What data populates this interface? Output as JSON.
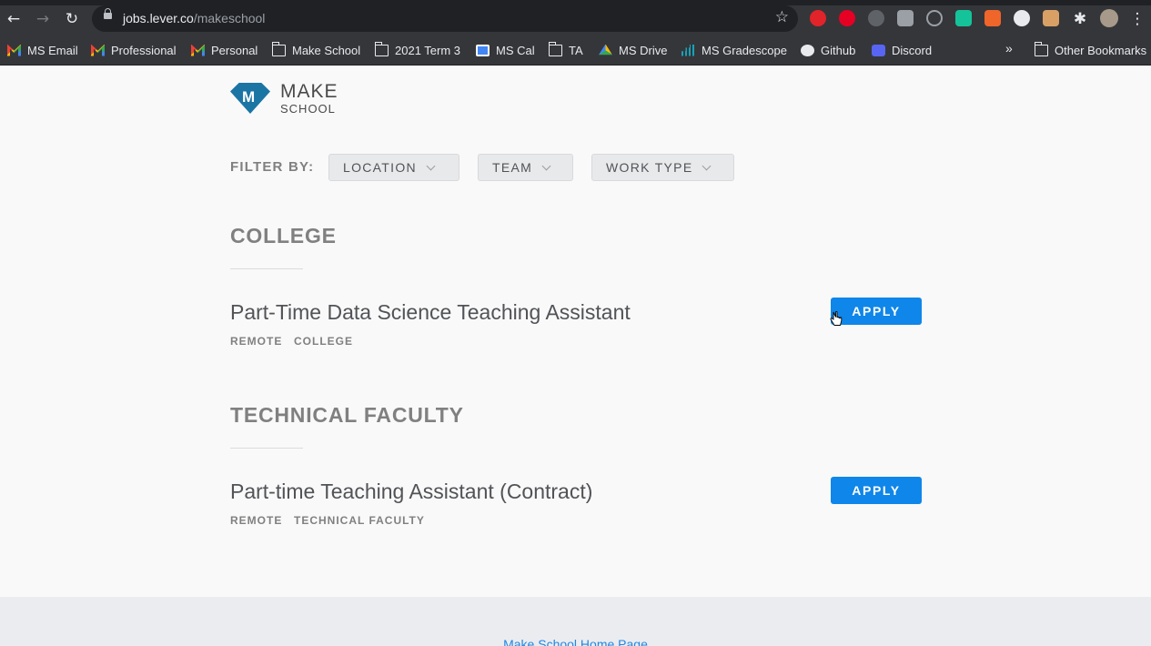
{
  "browser": {
    "url_host": "jobs.lever.co",
    "url_path": "/makeschool",
    "bookmarks": [
      {
        "label": "MS Email",
        "icon": "gmail-icon"
      },
      {
        "label": "Professional",
        "icon": "gmail-icon"
      },
      {
        "label": "Personal",
        "icon": "gmail-icon"
      },
      {
        "label": "Make School",
        "icon": "folder-icon"
      },
      {
        "label": "2021 Term 3",
        "icon": "folder-icon"
      },
      {
        "label": "MS Cal",
        "icon": "calendar-icon"
      },
      {
        "label": "TA",
        "icon": "folder-icon"
      },
      {
        "label": "MS Drive",
        "icon": "drive-icon"
      },
      {
        "label": "MS Gradescope",
        "icon": "gradescope-icon"
      },
      {
        "label": "Github",
        "icon": "github-icon"
      },
      {
        "label": "Discord",
        "icon": "discord-icon"
      }
    ],
    "more_label": "»",
    "other_bookmarks": "Other Bookmarks"
  },
  "logo": {
    "line1": "MAKE",
    "line2": "SCHOOL",
    "mark": "M"
  },
  "filters": {
    "label": "FILTER BY:",
    "items": [
      "LOCATION",
      "TEAM",
      "WORK TYPE"
    ]
  },
  "sections": [
    {
      "title": "COLLEGE",
      "jobs": [
        {
          "title": "Part-Time Data Science Teaching Assistant",
          "tags": [
            "REMOTE",
            "COLLEGE"
          ],
          "apply": "APPLY"
        }
      ]
    },
    {
      "title": "TECHNICAL FACULTY",
      "jobs": [
        {
          "title": "Part-time Teaching Assistant (Contract)",
          "tags": [
            "REMOTE",
            "TECHNICAL FACULTY"
          ],
          "apply": "APPLY"
        }
      ]
    }
  ],
  "footer": {
    "link": "Make School Home Page"
  },
  "colors": {
    "accent": "#0f86e9",
    "brand": "#1b75a4"
  }
}
